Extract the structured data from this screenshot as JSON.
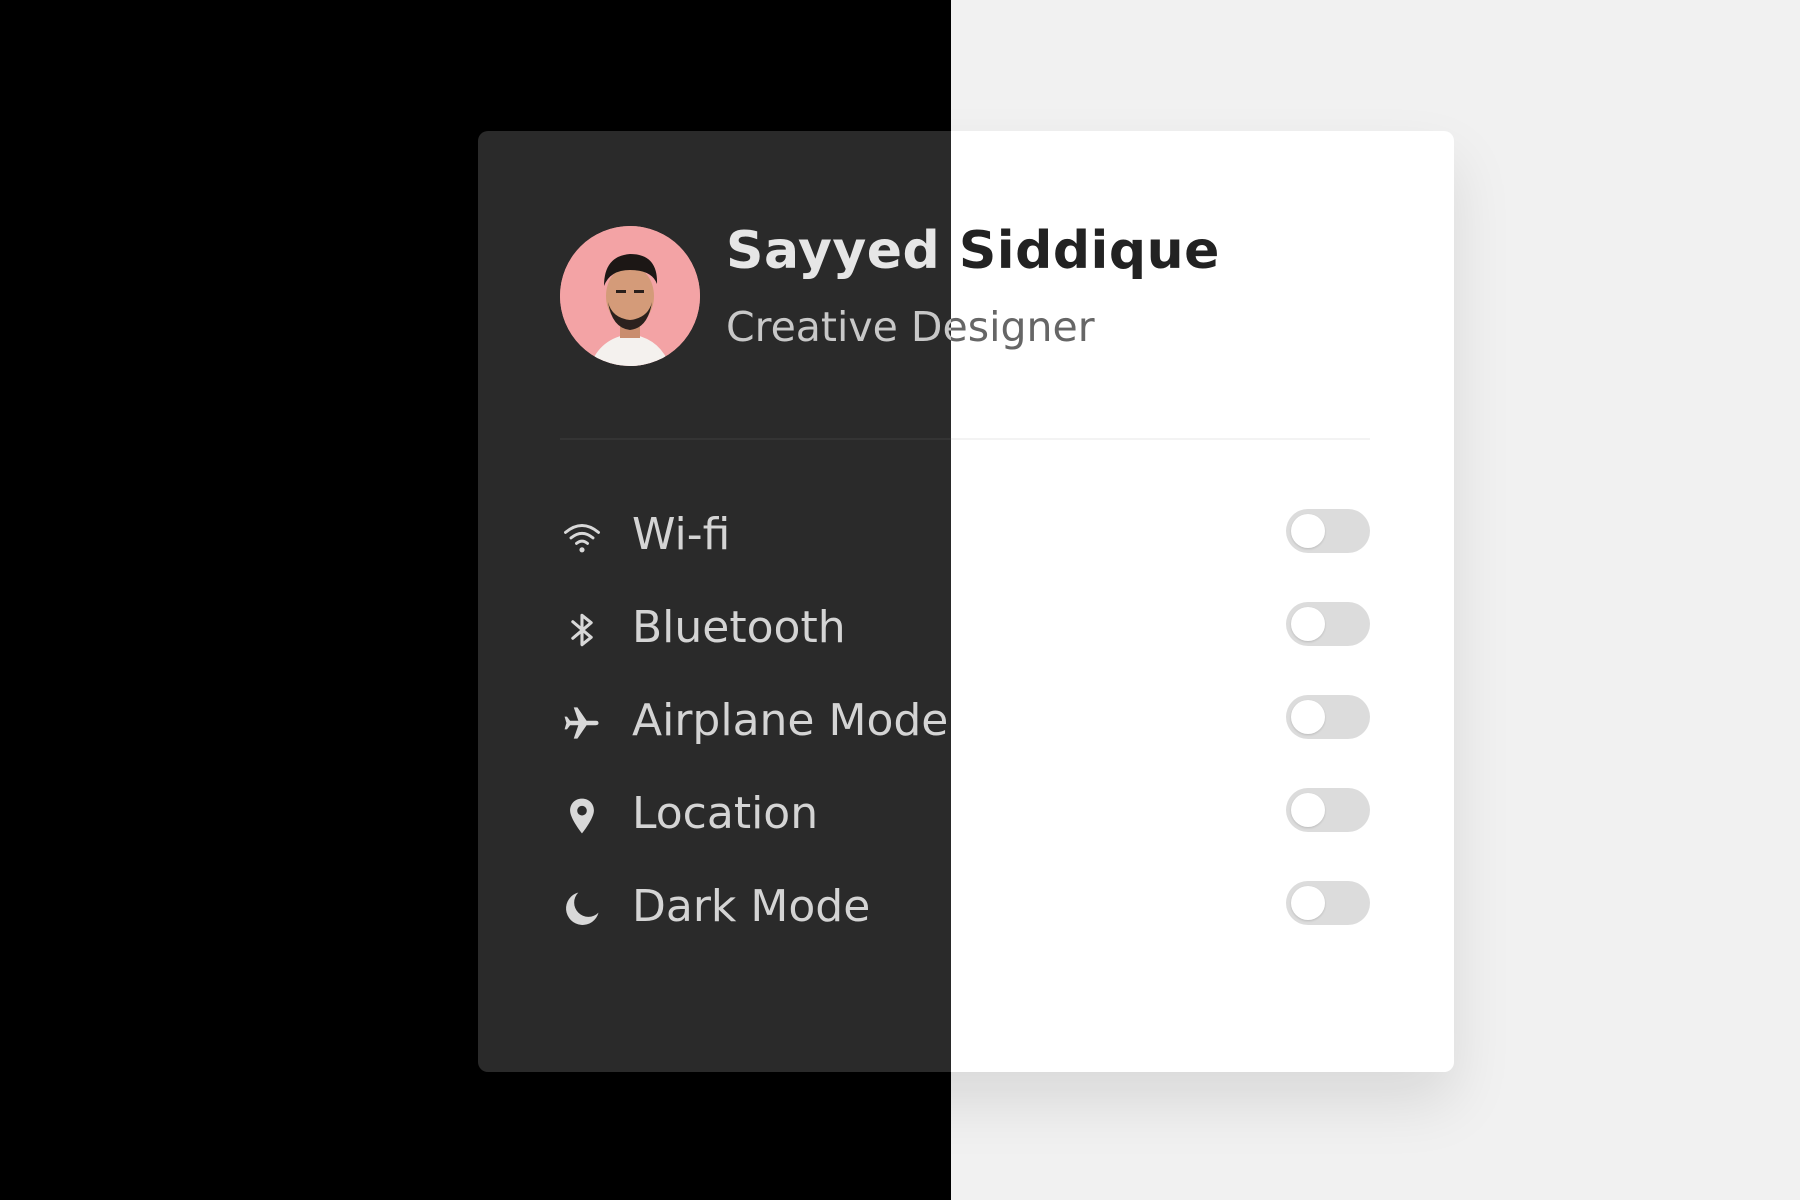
{
  "profile": {
    "name": "Sayyed Siddique",
    "role": "Creative Designer",
    "avatar_bg": "#f3a3a5"
  },
  "settings": [
    {
      "icon": "wifi-icon",
      "label": "Wi-fi",
      "enabled": false
    },
    {
      "icon": "bluetooth-icon",
      "label": "Bluetooth",
      "enabled": false
    },
    {
      "icon": "airplane-icon",
      "label": "Airplane Mode",
      "enabled": false
    },
    {
      "icon": "location-pin-icon",
      "label": "Location",
      "enabled": false
    },
    {
      "icon": "moon-icon",
      "label": "Dark Mode",
      "enabled": false
    }
  ],
  "colors": {
    "page_dark": "#000000",
    "page_light": "#f1f1f1",
    "card_dark": "#2a2a2a",
    "card_light": "#ffffff",
    "toggle_off": "#dcdcdc"
  }
}
